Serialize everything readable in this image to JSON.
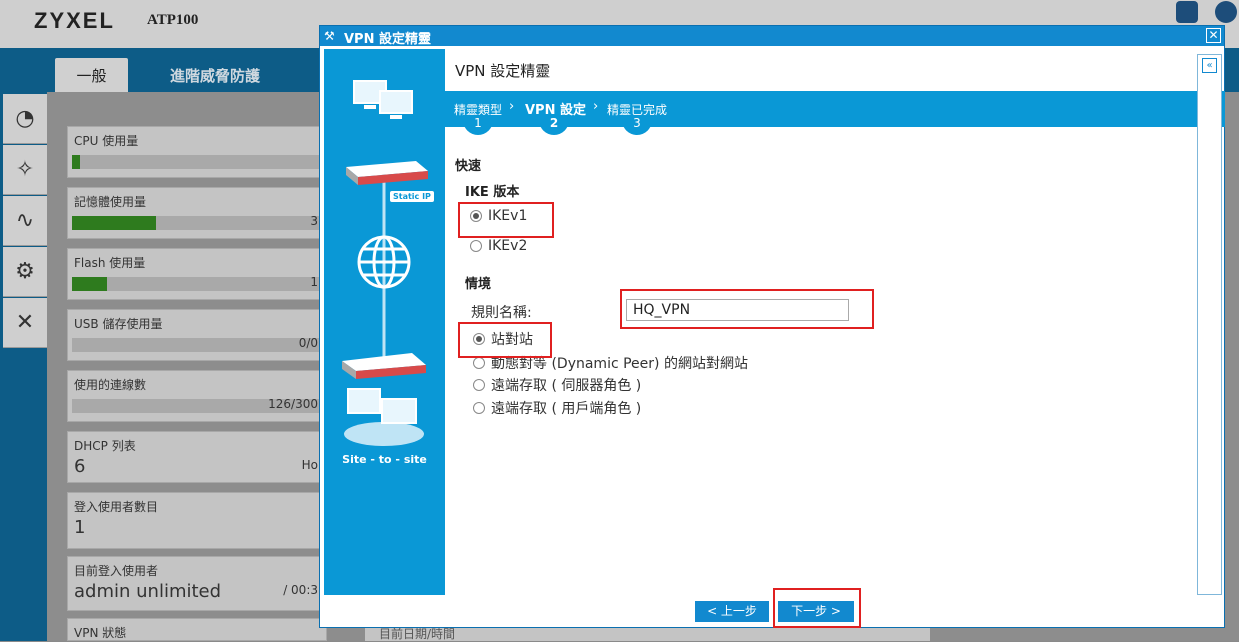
{
  "app": {
    "brand": "ZYXEL",
    "model": "ATP100",
    "tabs": [
      "一般",
      "進階威脅防護"
    ]
  },
  "dashboard": {
    "cpu": {
      "label": "CPU 使用量",
      "fill_fraction": 0.03
    },
    "memory": {
      "label": "記憶體使用量",
      "value": "3",
      "fill_fraction": 0.33
    },
    "flash": {
      "label": "Flash 使用量",
      "value": "1",
      "fill_fraction": 0.14
    },
    "usb": {
      "label": "USB 儲存使用量",
      "value": "0/0"
    },
    "sessions": {
      "label": "使用的連線數",
      "value": "126/300"
    },
    "dhcp": {
      "label": "DHCP 列表",
      "value": "6",
      "suffix": "Ho"
    },
    "login_count": {
      "label": "登入使用者數目",
      "value": "1"
    },
    "current_user": {
      "label": "目前登入使用者",
      "value": "admin unlimited",
      "suffix": "/ 00:3"
    },
    "vpn": {
      "label": "VPN 狀態"
    },
    "datetime": {
      "label": "目前日期/時間"
    }
  },
  "wizard": {
    "window_title": "VPN 設定精靈",
    "heading": "VPN 設定精靈",
    "left_caption": "Site - to - site",
    "static_ip_badge": "Static IP",
    "steps": [
      {
        "label": "精靈類型",
        "num": "1"
      },
      {
        "label": "VPN 設定",
        "num": "2"
      },
      {
        "label": "精靈已完成",
        "num": "3"
      }
    ],
    "section_quick": "快速",
    "section_ike": "IKE 版本",
    "ike_options": [
      "IKEv1",
      "IKEv2"
    ],
    "section_scenario": "情境",
    "rule_name_label": "規則名稱:",
    "rule_name_value": "HQ_VPN",
    "scenario_options": [
      "站對站",
      "動態對等 (Dynamic Peer) 的網站對網站",
      "遠端存取 ( 伺服器角色 )",
      "遠端存取 ( 用戶端角色 )"
    ],
    "prev_button": "< 上一步",
    "next_button": "下一步 >"
  }
}
